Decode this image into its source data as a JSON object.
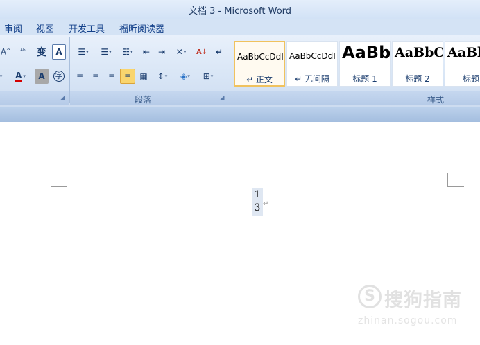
{
  "window": {
    "title": "文档 3 - Microsoft Word"
  },
  "menu": {
    "tabs": [
      "审阅",
      "视图",
      "开发工具",
      "福昕阅读器"
    ]
  },
  "ribbon": {
    "font_group": {
      "row1": [
        {
          "icon": "grow-font-icon",
          "glyph": "A˄"
        },
        {
          "icon": "clear-format-icon",
          "glyph": "ᴬᵇ"
        },
        {
          "icon": "phonetic-guide-icon",
          "glyph": "变"
        },
        {
          "icon": "character-border-icon",
          "glyph": "A"
        }
      ],
      "row2": [
        {
          "icon": "font-color-icon",
          "glyph": "A"
        },
        {
          "icon": "character-shading-icon",
          "glyph": "A"
        },
        {
          "icon": "enclose-character-icon",
          "glyph": "字"
        }
      ],
      "accent_red": "#d40000"
    },
    "paragraph_group": {
      "label": "段落",
      "row1": [
        {
          "icon": "bullets-icon",
          "glyph": "☰"
        },
        {
          "icon": "numbering-icon",
          "glyph": "☰"
        },
        {
          "icon": "multilevel-list-icon",
          "glyph": "☷"
        },
        {
          "icon": "decrease-indent-icon",
          "glyph": "⇤"
        },
        {
          "icon": "increase-indent-icon",
          "glyph": "⇥"
        },
        {
          "icon": "chinese-layout-icon",
          "glyph": "✕"
        },
        {
          "icon": "sort-icon",
          "glyph": "A↓"
        },
        {
          "icon": "show-marks-icon",
          "glyph": "↵"
        }
      ],
      "row2": [
        {
          "icon": "align-left-icon",
          "glyph": "≡"
        },
        {
          "icon": "align-center-icon",
          "glyph": "≡"
        },
        {
          "icon": "align-right-icon",
          "glyph": "≡"
        },
        {
          "icon": "justify-icon",
          "glyph": "≡"
        },
        {
          "icon": "distributed-icon",
          "glyph": "▦"
        },
        {
          "icon": "line-spacing-icon",
          "glyph": "↕"
        },
        {
          "icon": "shading-icon",
          "glyph": "◈"
        },
        {
          "icon": "borders-icon",
          "glyph": "⊞"
        }
      ]
    },
    "styles_group": {
      "label": "样式",
      "items": [
        {
          "sample": "AaBbCcDdI",
          "name": "↵ 正文",
          "selected": true
        },
        {
          "sample": "AaBbCcDdI",
          "name": "↵ 无间隔",
          "selected": false
        },
        {
          "sample": "AaBb",
          "name": "标题 1",
          "selected": false
        },
        {
          "sample": "AaBbC",
          "name": "标题 2",
          "selected": false
        },
        {
          "sample": "AaBb",
          "name": "标题",
          "selected": false
        }
      ]
    }
  },
  "document": {
    "equation": {
      "numerator": "1",
      "denominator": "3"
    },
    "paragraph_mark": "↵"
  },
  "watermark": {
    "logo": "S",
    "text": "搜狗指南",
    "url": "zhinan.sogou.com"
  }
}
